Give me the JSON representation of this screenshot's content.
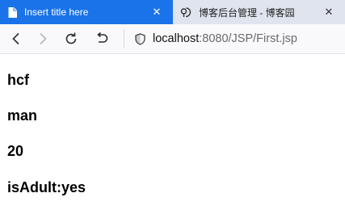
{
  "tabs": [
    {
      "title": "Insert title here",
      "icon": "page-icon",
      "active": true
    },
    {
      "title": "博客后台管理 - 博客园",
      "icon": "cnblogs-icon",
      "active": false
    }
  ],
  "toolbar": {
    "url_host": "localhost",
    "url_rest": ":8080/JSP/First.jsp"
  },
  "content": {
    "lines": [
      "hcf",
      "man",
      "20",
      "isAdult:yes"
    ]
  },
  "colors": {
    "active_tab": "#1a73e8",
    "tabstrip": "#dfe4ee",
    "toolbar": "#f9f9fb"
  }
}
